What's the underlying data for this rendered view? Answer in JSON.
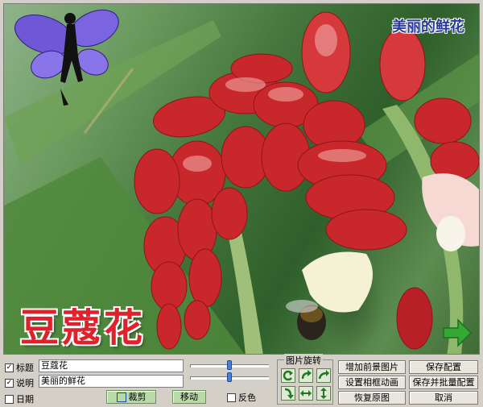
{
  "overlay": {
    "caption": "美丽的鲜花",
    "flower_name": "豆蔻花"
  },
  "controls": {
    "title_checkbox": {
      "label": "标题",
      "checked": true,
      "value": "豆蔻花"
    },
    "desc_checkbox": {
      "label": "说明",
      "checked": true,
      "value": "美丽的鲜花"
    },
    "date_checkbox": {
      "label": "日期",
      "checked": false
    },
    "crop_button": "裁剪",
    "move_button": "移动",
    "invert_checkbox": {
      "label": "反色",
      "checked": false
    },
    "slider1_level": 0.5,
    "slider2_level": 0.5
  },
  "rotation": {
    "label": "图片旋转",
    "icons": [
      "rotate-ccw-icon",
      "rotate-cw-icon",
      "flip-up-right-icon",
      "flip-down-icon",
      "flip-horizontal-icon",
      "flip-vertical-icon"
    ]
  },
  "actions": {
    "add_foreground": "增加前景图片",
    "save_config": "保存配置",
    "frame_animation": "设置相框动画",
    "save_batch": "保存并批量配置",
    "restore": "恢复原图",
    "cancel": "取消"
  },
  "colors": {
    "flower_red": "#c8282c",
    "caption_blue": "#2a3a9c",
    "name_red": "#e0202a",
    "next_green": "#33a833"
  }
}
